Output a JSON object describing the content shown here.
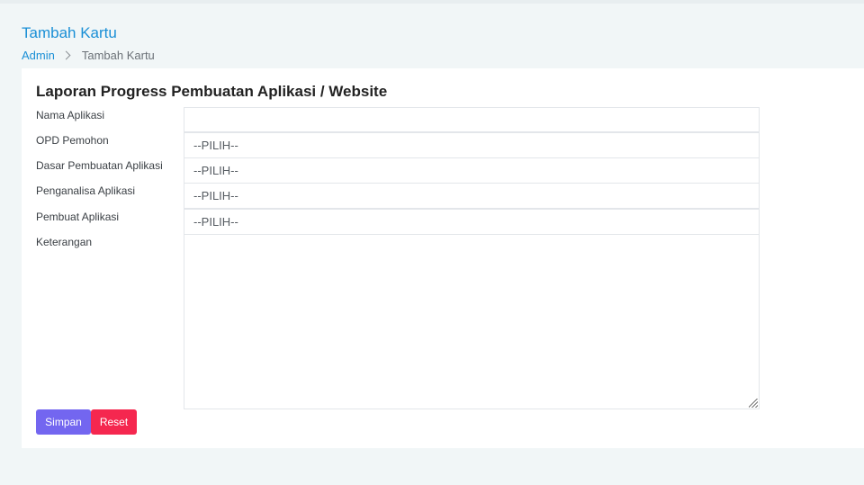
{
  "header": {
    "title": "Tambah Kartu",
    "breadcrumb": {
      "root": "Admin",
      "current": "Tambah Kartu"
    }
  },
  "form": {
    "title": "Laporan Progress Pembuatan Aplikasi / Website",
    "fields": {
      "nama_aplikasi": {
        "label": "Nama Aplikasi",
        "value": ""
      },
      "opd_pemohon": {
        "label": "OPD Pemohon",
        "value": "--PILIH--"
      },
      "dasar_pembuatan": {
        "label": "Dasar Pembuatan Aplikasi",
        "value": "--PILIH--"
      },
      "penganalisa": {
        "label": "Penganalisa Aplikasi",
        "value": "--PILIH--"
      },
      "pembuat": {
        "label": "Pembuat Aplikasi",
        "value": "--PILIH--"
      },
      "keterangan": {
        "label": "Keterangan",
        "value": ""
      }
    },
    "buttons": {
      "save_label": "Simpan",
      "reset_label": "Reset"
    }
  },
  "colors": {
    "link": "#1a8fd6",
    "save_button": "#7366f0",
    "reset_button": "#f5274f",
    "page_background": "#f1f6f7"
  }
}
